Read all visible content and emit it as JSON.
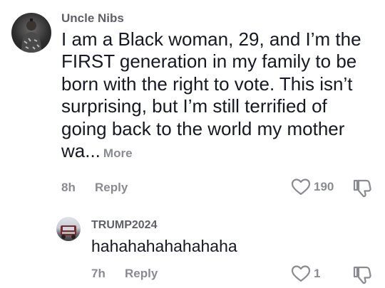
{
  "comment": {
    "username": "Uncle Nibs",
    "text": "I am a Black woman, 29, and I’m the FIRST generation in my family to be born with the right to vote. This isn’t surprising, but I’m still terrified of going back to the world my mother wa...",
    "more_label": "More",
    "time": "8h",
    "reply_label": "Reply",
    "likes": "190",
    "icons": {
      "like": "heart-outline-icon",
      "dislike": "thumbs-down-icon"
    }
  },
  "reply": {
    "username": "TRUMP2024",
    "text": "hahahahahahahaha",
    "time": "7h",
    "reply_label": "Reply",
    "likes": "1",
    "icons": {
      "like": "heart-outline-icon",
      "dislike": "thumbs-down-icon"
    }
  }
}
